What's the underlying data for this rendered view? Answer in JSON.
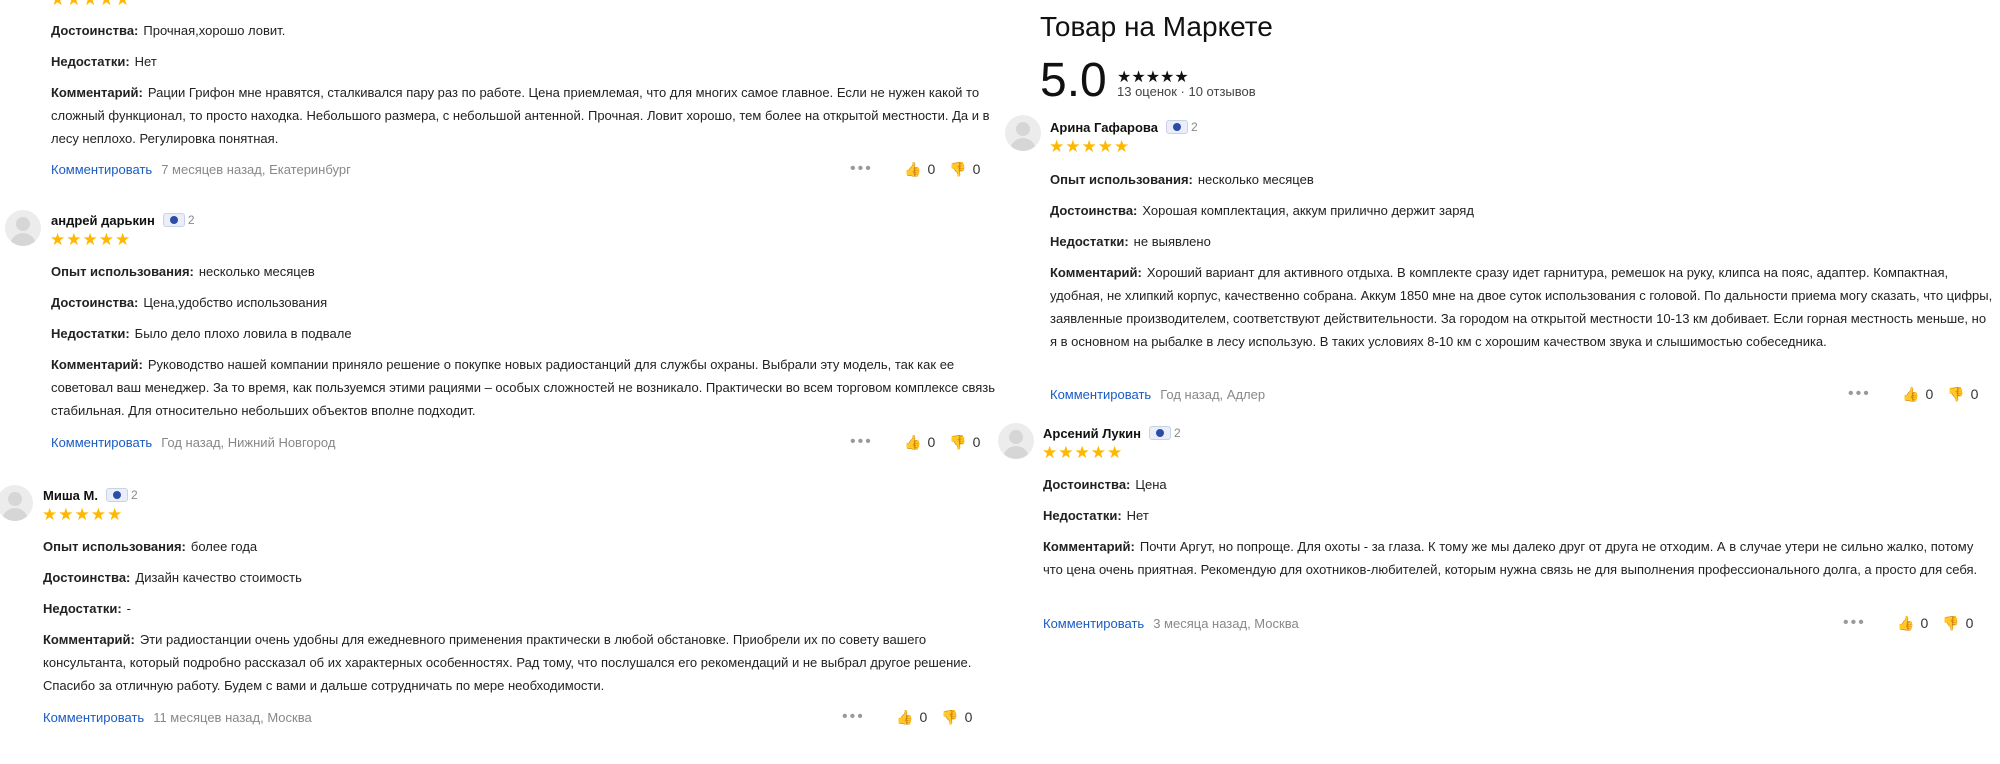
{
  "market": {
    "title": "Товар на Маркете",
    "rating": "5.0",
    "summary": "13 оценок · 10 отзывов"
  },
  "labels": {
    "experience": "Опыт использования:",
    "pros": "Достоинства:",
    "cons": "Недостатки:",
    "comment": "Комментарий:",
    "reply": "Комментировать",
    "dots": "•••"
  },
  "reviews": {
    "r0": {
      "pros": "Прочная,хорошо ловит.",
      "cons": "Нет",
      "comment": "Рации Грифон мне нравятся, сталкивался пару раз по работе. Цена приемлемая, что для многих самое главное. Если не нужен какой то сложный функционал, то просто находка. Небольшого размера, с небольшой антенной. Прочная. Ловит хорошо, тем более на открытой местности. Да и в лесу неплохо. Регулировка понятная.",
      "when": "7 месяцев назад, Екатеринбург",
      "likes": "0",
      "dislikes": "0"
    },
    "r1": {
      "author": "андрей дарькин",
      "level": "2",
      "experience": "несколько месяцев",
      "pros": "Цена,удобство использования",
      "cons": "Было дело плохо ловила в подвале",
      "comment": "Руководство нашей компании приняло решение о покупке новых радиостанций для службы охраны. Выбрали эту модель, так как ее советовал ваш менеджер. За то время, как пользуемся этими рациями – особых сложностей не возникало. Практически во всем торговом комплексе связь стабильная. Для относительно небольших объектов вполне подходит.",
      "when": "Год назад, Нижний Новгород",
      "likes": "0",
      "dislikes": "0"
    },
    "r2": {
      "author": "Миша М.",
      "level": "2",
      "experience": "более года",
      "pros": "Дизайн качество стоимость",
      "cons": "-",
      "comment": "Эти радиостанции очень удобны для ежедневного применения практически в любой обстановке. Приобрели их по совету вашего консультанта, который подробно рассказал об их характерных особенностях. Рад тому, что послушался его рекомендаций и не выбрал другое решение. Спасибо за отличную работу. Будем с вами и дальше сотрудничать по мере необходимости.",
      "when": "11 месяцев назад, Москва",
      "likes": "0",
      "dislikes": "0"
    },
    "r3": {
      "author": "Арина Гафарова",
      "level": "2",
      "experience": "несколько месяцев",
      "pros": "Хорошая комплектация, аккум прилично держит заряд",
      "cons": "не выявлено",
      "comment": "Хороший вариант для активного отдыха. В комплекте сразу идет гарнитура, ремешок на руку, клипса на пояс, адаптер. Компактная, удобная, не хлипкий корпус, качественно собрана. Аккум 1850 мне на двое суток использования с головой. По дальности приема могу сказать, что цифры, заявленные производителем, соответствуют действительности. За городом на открытой местности 10-13 км добивает. Если горная местность меньше, но я в основном на рыбалке в лесу использую. В таких условиях 8-10 км с хорошим качеством звука и слышимостью собеседника.",
      "when": "Год назад, Адлер",
      "likes": "0",
      "dislikes": "0"
    },
    "r4": {
      "author": "Арсений Лукин",
      "level": "2",
      "pros": "Цена",
      "cons": "Нет",
      "comment": "Почти Аргут, но попроще. Для охоты - за глаза. К тому же мы далеко друг от друга не отходим. А в случае утери не сильно жалко, потому что цена очень приятная. Рекомендую для охотников-любителей, которым нужна связь не для выполнения профессионального долга, а просто для себя.",
      "when": "3 месяца назад, Москва",
      "likes": "0",
      "dislikes": "0"
    }
  },
  "colors": {
    "star": "#ffb800",
    "link": "#1a5bc4",
    "muted": "#888888"
  }
}
